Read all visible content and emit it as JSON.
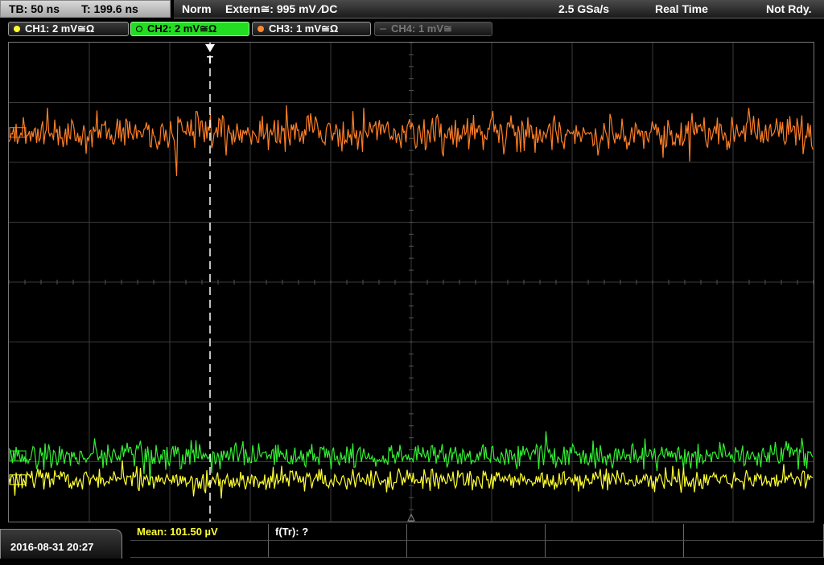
{
  "header": {
    "timebase": "TB: 50 ns",
    "trigger_time": "T: 199.6 ns",
    "trigger_mode": "Norm",
    "trigger_source": "Extern≅: 995 mV ⁄DC",
    "sample_rate": "2.5 GSa/s",
    "acq_mode": "Real Time",
    "status": "Not Rdy."
  },
  "channels": [
    {
      "label": "CH1: 2 mV≅Ω",
      "color": "#ffff33",
      "state": "on"
    },
    {
      "label": "CH2: 2 mV≅Ω",
      "color": "#22dd22",
      "state": "selected"
    },
    {
      "label": "CH3: 1 mV≅Ω",
      "color": "#ff8833",
      "state": "on"
    },
    {
      "label": "CH4: 1 mV≅",
      "color": "#777777",
      "state": "off"
    }
  ],
  "footer": {
    "datetime": "2016-08-31 20:27",
    "measurement": "Mean: 101.50 µV",
    "frequency": "f(Tr): ?"
  },
  "colors": {
    "ch1": "#ffff33",
    "ch2": "#33ee33",
    "ch3": "#ff7f27",
    "grid": "#3a3a3a",
    "trigger_marker": "#ffffff"
  },
  "chart_data": {
    "type": "line",
    "grid": {
      "divisions_x": 10,
      "divisions_y": 8
    },
    "series": [
      {
        "name": "CH3",
        "level_div": 1.5,
        "noise_div": 0.6
      },
      {
        "name": "CH2",
        "level_div": 6.9,
        "noise_div": 0.4
      },
      {
        "name": "CH1",
        "level_div": 7.3,
        "noise_div": 0.35
      }
    ],
    "trigger_position_div": 2.5
  }
}
